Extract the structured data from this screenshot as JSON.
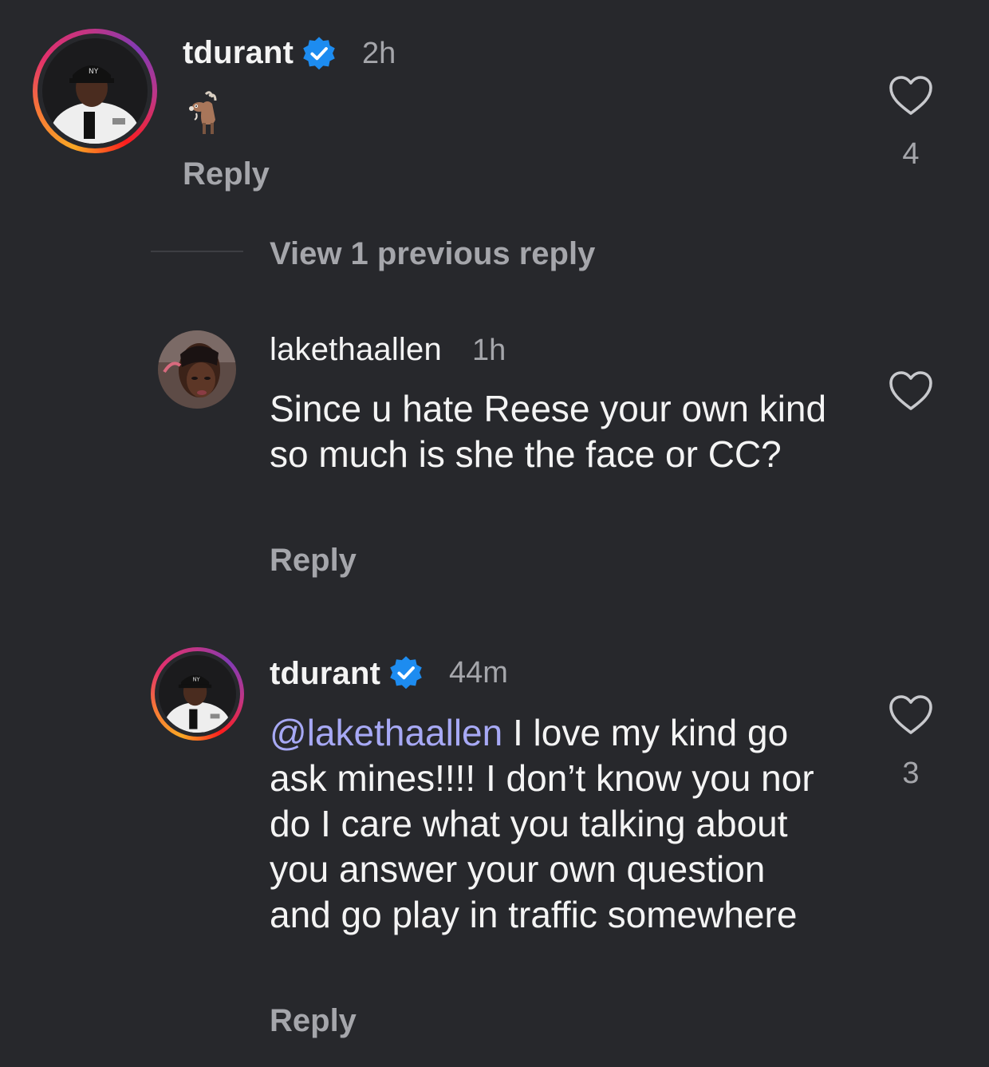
{
  "comments": [
    {
      "username": "tdurant",
      "time": "2h",
      "reply_label": "Reply",
      "likes": "4",
      "emoji": "goat",
      "verified": true
    },
    {
      "username": "lakethaallen",
      "time": "1h",
      "text": "Since u hate Reese your own kind  so much is she the face or CC?",
      "reply_label": "Reply"
    },
    {
      "username": "tdurant",
      "time": "44m",
      "mention": "@lakethaallen",
      "text": "I love my kind go ask mines!!!! I don’t know you nor do I care what you talking about you answer your own question and go play in traffic somewhere",
      "reply_label": "Reply",
      "likes": "3",
      "verified": true
    }
  ],
  "view_replies_label": "View 1 previous reply",
  "colors": {
    "background": "#27282c",
    "muted": "#a5a6ab",
    "mention": "#a7a9f5",
    "verified": "#1d8cf0"
  }
}
